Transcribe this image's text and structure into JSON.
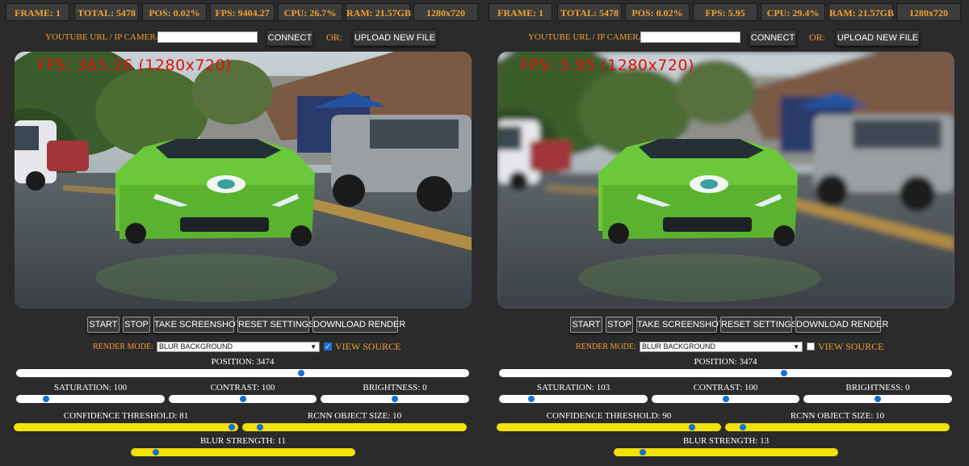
{
  "accent": "#f0a030",
  "slider_knob_color": "#1370d8",
  "yellow_track_color": "#f2e20a",
  "panels": [
    {
      "stats": {
        "frame": "FRAME: 1",
        "total": "TOTAL: 5478",
        "pos": "POS: 0.02%",
        "fps": "FPS: 9404.27",
        "cpu": "CPU: 26.7%",
        "ram": "RAM: 21.57GB",
        "res": "1280x720"
      },
      "url_label": "YOUTUBE URL / IP CAMERA:",
      "url_value": "",
      "connect": "CONNECT",
      "or": "OR:",
      "upload": "UPLOAD NEW FILE",
      "overlay": "FPS: 365.26 (1280x720)",
      "blurred": false,
      "buttons": [
        "START",
        "STOP",
        "TAKE SCREENSHOT",
        "RESET SETTINGS",
        "DOWNLOAD RENDER"
      ],
      "render_mode_label": "RENDER MODE:",
      "render_mode_value": "BLUR BACKGROUND",
      "view_source_label": "VIEW SOURCE",
      "view_source_checked": true,
      "sliders": {
        "position": {
          "label": "POSITION: 3474",
          "fraction": 0.63
        },
        "saturation": {
          "label": "SATURATION: 100",
          "fraction": 0.2
        },
        "contrast": {
          "label": "CONTRAST: 100",
          "fraction": 0.5
        },
        "brightness": {
          "label": "BRIGHTNESS: 0",
          "fraction": 0.5
        },
        "confidence": {
          "label": "CONFIDENCE THRESHOLD: 81",
          "fraction": 0.97
        },
        "rcnn": {
          "label": "RCNN OBJECT SIZE: 10",
          "fraction": 0.08
        },
        "blur": {
          "label": "BLUR STRENGTH: 11",
          "fraction": 0.11
        }
      }
    },
    {
      "stats": {
        "frame": "FRAME: 1",
        "total": "TOTAL: 5478",
        "pos": "POS: 0.02%",
        "fps": "FPS: 5.95",
        "cpu": "CPU: 29.4%",
        "ram": "RAM: 21.57GB",
        "res": "1280x720"
      },
      "url_label": "YOUTUBE URL / IP CAMERA:",
      "url_value": "",
      "connect": "CONNECT",
      "or": "OR:",
      "upload": "UPLOAD NEW FILE",
      "overlay": "FPS: 5.95 (1280x720)",
      "blurred": true,
      "buttons": [
        "START",
        "STOP",
        "TAKE SCREENSHOT",
        "RESET SETTINGS",
        "DOWNLOAD RENDER"
      ],
      "render_mode_label": "RENDER MODE:",
      "render_mode_value": "BLUR BACKGROUND",
      "view_source_label": "VIEW SOURCE",
      "view_source_checked": false,
      "sliders": {
        "position": {
          "label": "POSITION: 3474",
          "fraction": 0.63
        },
        "saturation": {
          "label": "SATURATION: 103",
          "fraction": 0.22
        },
        "contrast": {
          "label": "CONTRAST: 100",
          "fraction": 0.5
        },
        "brightness": {
          "label": "BRIGHTNESS: 0",
          "fraction": 0.5
        },
        "confidence": {
          "label": "CONFIDENCE THRESHOLD: 90",
          "fraction": 0.87
        },
        "rcnn": {
          "label": "RCNN OBJECT SIZE: 10",
          "fraction": 0.08
        },
        "blur": {
          "label": "BLUR STRENGTH: 13",
          "fraction": 0.13
        }
      }
    }
  ]
}
